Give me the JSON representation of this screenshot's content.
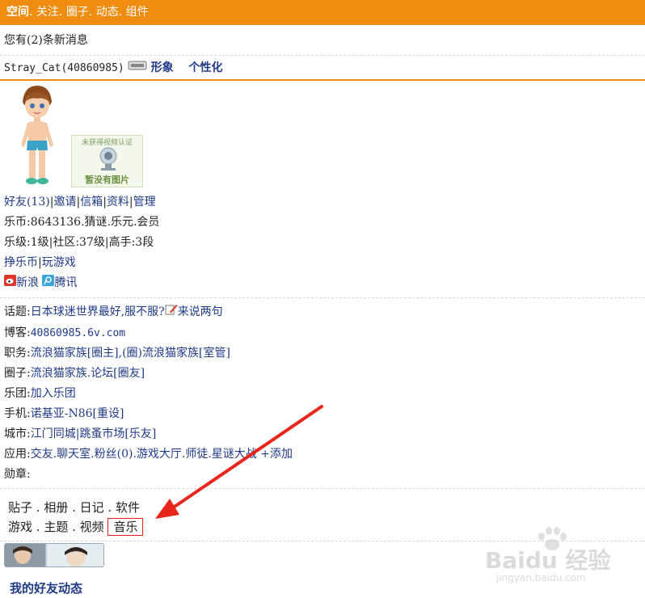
{
  "topnav": {
    "items": [
      "空间",
      "关注",
      "圈子",
      "动态",
      "组件"
    ]
  },
  "messages": {
    "text": "您有(2)条新消息"
  },
  "user": {
    "name": "Stray_Cat(40860985)",
    "links": [
      "形象",
      "个性化"
    ]
  },
  "verify": {
    "line1": "未获得视频认证",
    "line2": "暂没有图片"
  },
  "profile": {
    "friends": [
      "好友(13)",
      "邀请",
      "信箱",
      "资料",
      "管理"
    ],
    "coins": "乐币:8643136.猜谜.乐元.会员",
    "levels": [
      "乐级:1级",
      "社区:37级",
      "高手:3段"
    ],
    "earn": [
      "挣乐币",
      "玩游戏"
    ],
    "share": [
      "新浪",
      "腾讯"
    ]
  },
  "info": {
    "topic_label": "话题:",
    "topic": "日本球迷世界最好,服不服?",
    "topic_action": "来说两句",
    "blog_label": "博客:",
    "blog": "40860985.6v.com",
    "job_label": "职务:",
    "job": "流浪猫家族[圈主],(圈)流浪猫家族[室管]",
    "circle_label": "圈子:",
    "circle": "流浪猫家族.论坛[圈友]",
    "band_label": "乐团:",
    "band": "加入乐团",
    "phone_label": "手机:",
    "phone": "诺基亚-N86[重设]",
    "city_label": "城市:",
    "city": "江门同城|跳蚤市场[乐友]",
    "apps_label": "应用:",
    "apps": "交友.聊天室.粉丝(0).游戏大厅.师徒.星谜大战 +添加",
    "medal_label": "勋章:"
  },
  "modules": {
    "row1": [
      "贴子",
      "相册",
      "日记",
      "软件"
    ],
    "row2": [
      "游戏",
      "主题",
      "视频"
    ],
    "music": "音乐"
  },
  "friends_feed": {
    "title": "我的好友动态"
  },
  "watermark": {
    "brand": "Baidu 经验",
    "url": "jingyan.baidu.com"
  },
  "colors": {
    "topbar": "#f08c0f",
    "link": "#1f3a88",
    "highlight": "#e2231a"
  }
}
